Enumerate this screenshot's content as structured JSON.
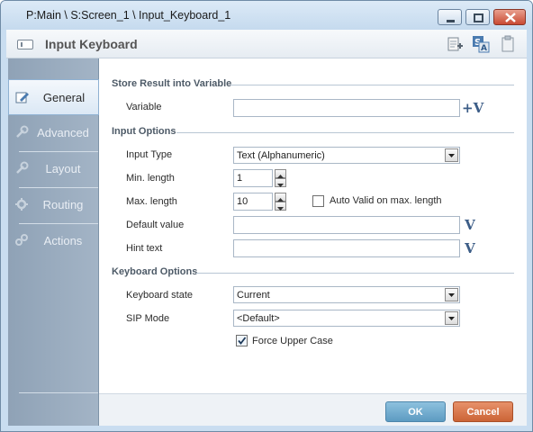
{
  "window": {
    "title": "P:Main \\ S:Screen_1 \\ Input_Keyboard_1"
  },
  "header": {
    "title": "Input Keyboard"
  },
  "nav": [
    {
      "label": "General",
      "icon": "pencil-icon",
      "active": true
    },
    {
      "label": "Advanced",
      "icon": "wrench-icon",
      "active": false
    },
    {
      "label": "Layout",
      "icon": "layout-icon",
      "active": false
    },
    {
      "label": "Routing",
      "icon": "gear-icon",
      "active": false
    },
    {
      "label": "Actions",
      "icon": "actions-icon",
      "active": false
    }
  ],
  "store": {
    "section": "Store Result into Variable",
    "variable_label": "Variable",
    "variable_value": "",
    "variable_button": "+V"
  },
  "input": {
    "section": "Input Options",
    "type_label": "Input Type",
    "type_value": "Text (Alphanumeric)",
    "min_label": "Min. length",
    "min_value": "1",
    "max_label": "Max. length",
    "max_value": "10",
    "auto_valid_label": "Auto Valid on max. length",
    "auto_valid_checked": false,
    "default_label": "Default value",
    "default_value": "",
    "hint_label": "Hint text",
    "hint_value": "",
    "v_button": "V"
  },
  "keyboard": {
    "section": "Keyboard Options",
    "state_label": "Keyboard state",
    "state_value": "Current",
    "sip_label": "SIP Mode",
    "sip_value": "<Default>",
    "force_upper_label": "Force Upper Case",
    "force_upper_checked": true
  },
  "footer": {
    "ok": "OK",
    "cancel": "Cancel"
  },
  "colors": {
    "accent": "#5d9bc2",
    "cancel": "#cb6436",
    "panel": "#9aacbf"
  }
}
